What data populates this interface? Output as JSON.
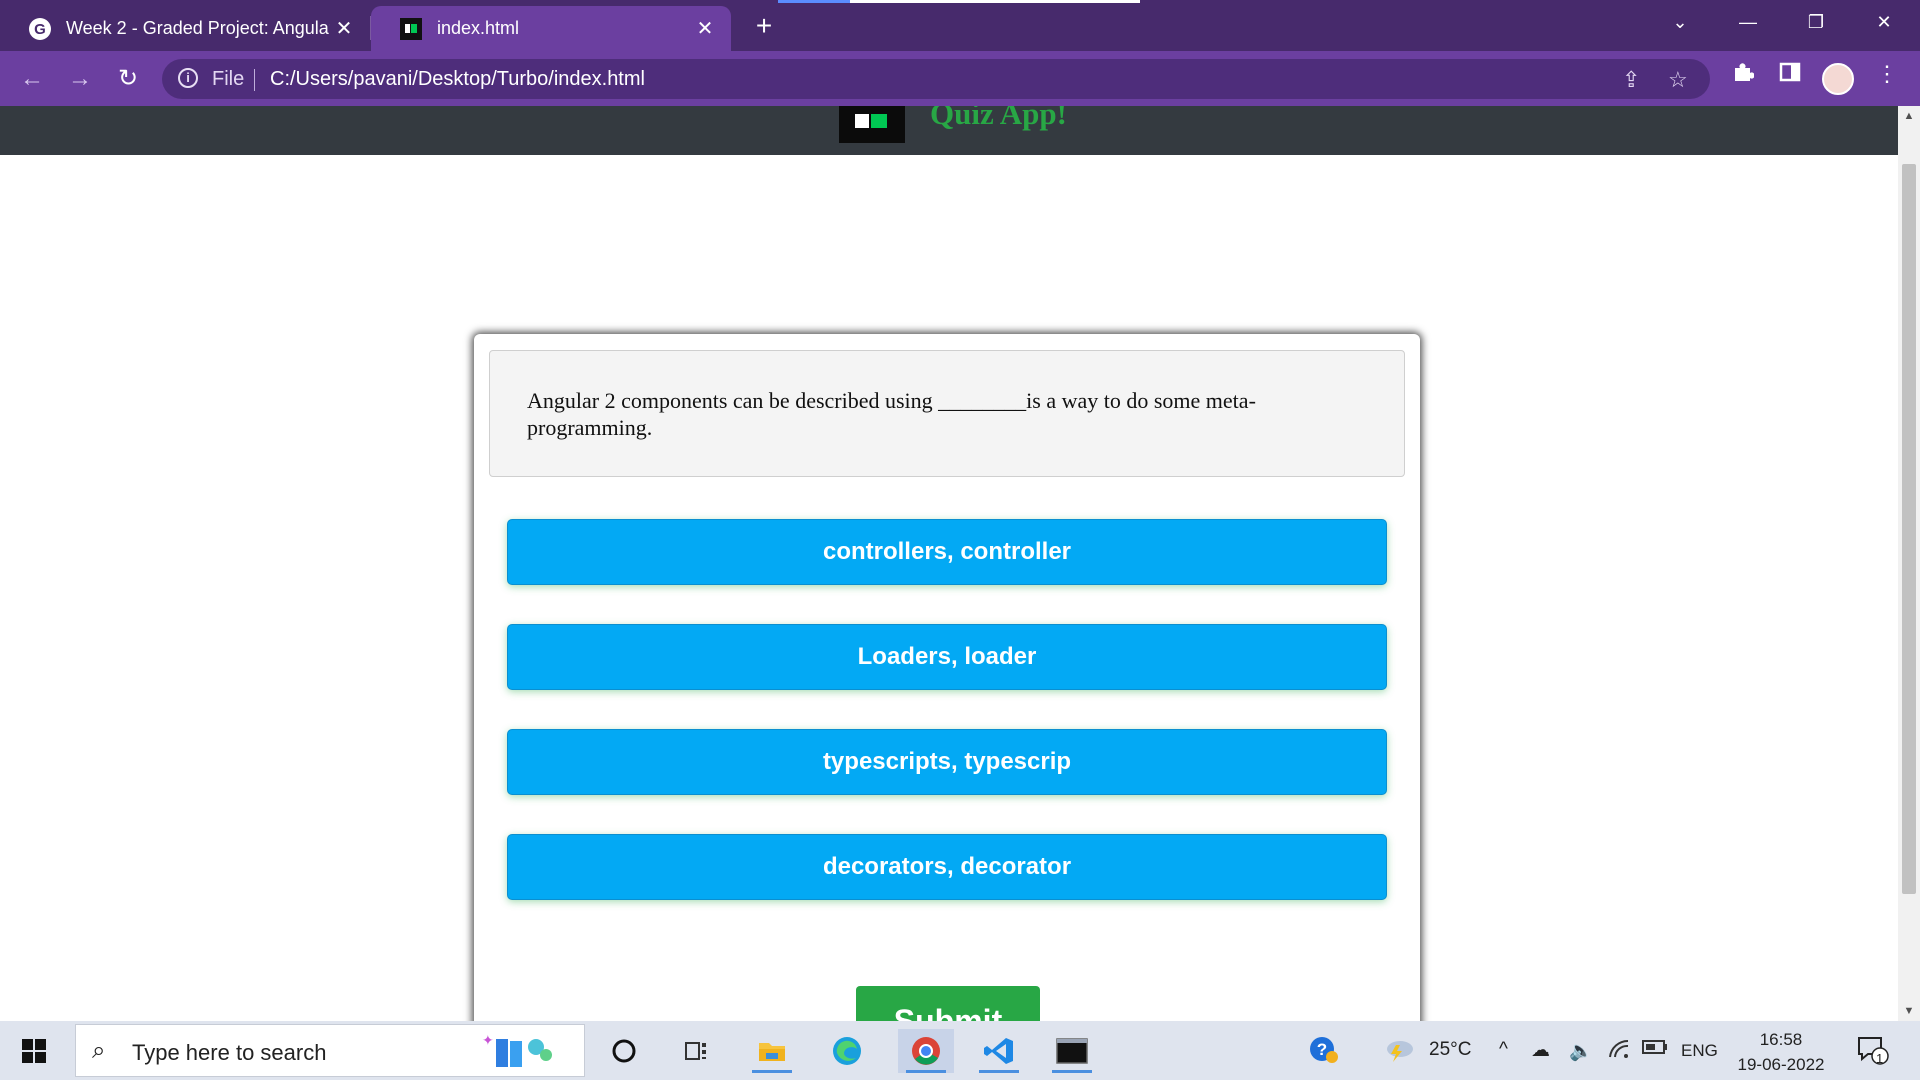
{
  "browser": {
    "tabs": [
      {
        "title": "Week 2 - Graded Project: Angular",
        "favicon": "google-g-icon"
      },
      {
        "title": "index.html",
        "favicon": "hackerearth-icon"
      }
    ],
    "new_tab_symbol": "+",
    "address": {
      "scheme_label": "File",
      "url": "C:/Users/pavani/Desktop/Turbo/index.html"
    }
  },
  "app": {
    "title": "Quiz App!",
    "question": "Angular 2 components can be described using ________is a way to do some meta-programming.",
    "answers": [
      "controllers, controller",
      "Loaders, loader",
      "typescripts, typescrip",
      "decorators, decorator"
    ],
    "submit_label": "Submit",
    "colors": {
      "answer_bg": "#03a9f4",
      "title": "#28a745",
      "submit_bg": "#28a745",
      "header_bg": "#343a40"
    }
  },
  "taskbar": {
    "search_placeholder": "Type here to search",
    "weather": "25°C",
    "language": "ENG",
    "time": "16:58",
    "date": "19-06-2022",
    "notification_count": "1"
  }
}
